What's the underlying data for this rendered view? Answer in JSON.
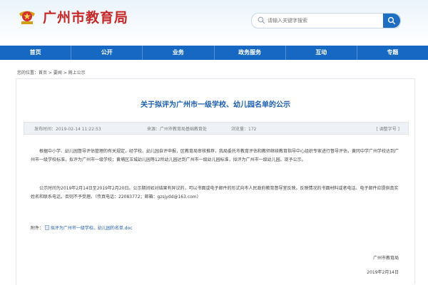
{
  "header": {
    "site_title": "广州市教育局",
    "search_placeholder": "请输入关键字搜索"
  },
  "nav": [
    "首页",
    "公开",
    "业务",
    "政务服务",
    "互动",
    "专题"
  ],
  "breadcrumb": "您的位置：首页 > 要闻 > 网上公示",
  "article": {
    "title": "关于拟评为广州市一级学校、幼儿园名单的公示",
    "meta": {
      "time": "发布时间：2019-02-14 11:22:53",
      "source": "来源：广州市教育局基础教育处",
      "views": "浏览量：172",
      "font_size": "[ 调整字号 ]"
    },
    "paragraphs": [
      "根据中小学、幼儿园督导评估管理的有关规定，经学校、幼儿园自评申报，区教育局审核推荐，我局委托市教育评估和教师继续教育指导中心组织专家进行督导评估，黄冈中学广州学校达到广州市一级学校标准，拟评为广州市一级学校；黄埔区玉城幼儿园等12所幼儿园达到广州市一级幼儿园标准，拟评为广州市一级幼儿园。现予公示。",
      "公示时间为2019年2月14日至2019年2月20日。公示期间如对结果有异议的，可以书面或电子邮件的形式向市人民政府教育督导室反映。反映情况的书面材料或者电话、电子邮件应提供真实姓名和联系电话，否则不予受理。（传真电话：22083772；邮箱：gzsjydd@163.com）"
    ],
    "attachment_label": "附件：",
    "attachment_name": "拟评为广州市一级学校、幼儿园的名单.doc",
    "sign_org": "广州市教育局",
    "sign_date": "2019年2月14日"
  },
  "colors": {
    "brand_red": "#c62828",
    "nav_blue": "#1668c2",
    "title_blue": "#1e5fb0"
  },
  "icons": [
    "emblem-logo",
    "search-icon",
    "attachment-icon"
  ]
}
